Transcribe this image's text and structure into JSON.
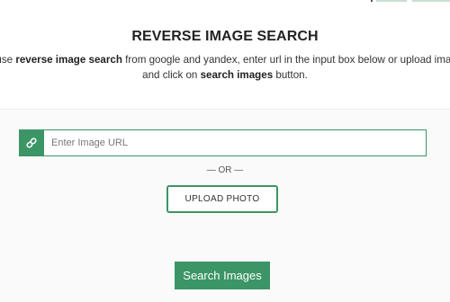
{
  "header": {
    "title": "REVERSE IMAGE SEARCH",
    "line1": {
      "pre": "o use ",
      "bold1": "reverse image search",
      "mid": " from google and yandex, enter url in the input box below or upload image"
    },
    "line2": {
      "pre": "and click on ",
      "bold1": "search images",
      "post": " button."
    }
  },
  "url_input": {
    "placeholder": "Enter Image URL",
    "value": "",
    "icon": "link-icon"
  },
  "separator": "— OR —",
  "upload_button": "UPLOAD PHOTO",
  "search_button": "Search Images",
  "colors": {
    "accent": "#3b9566",
    "background": "#fafafa",
    "panel": "#ffffff"
  }
}
